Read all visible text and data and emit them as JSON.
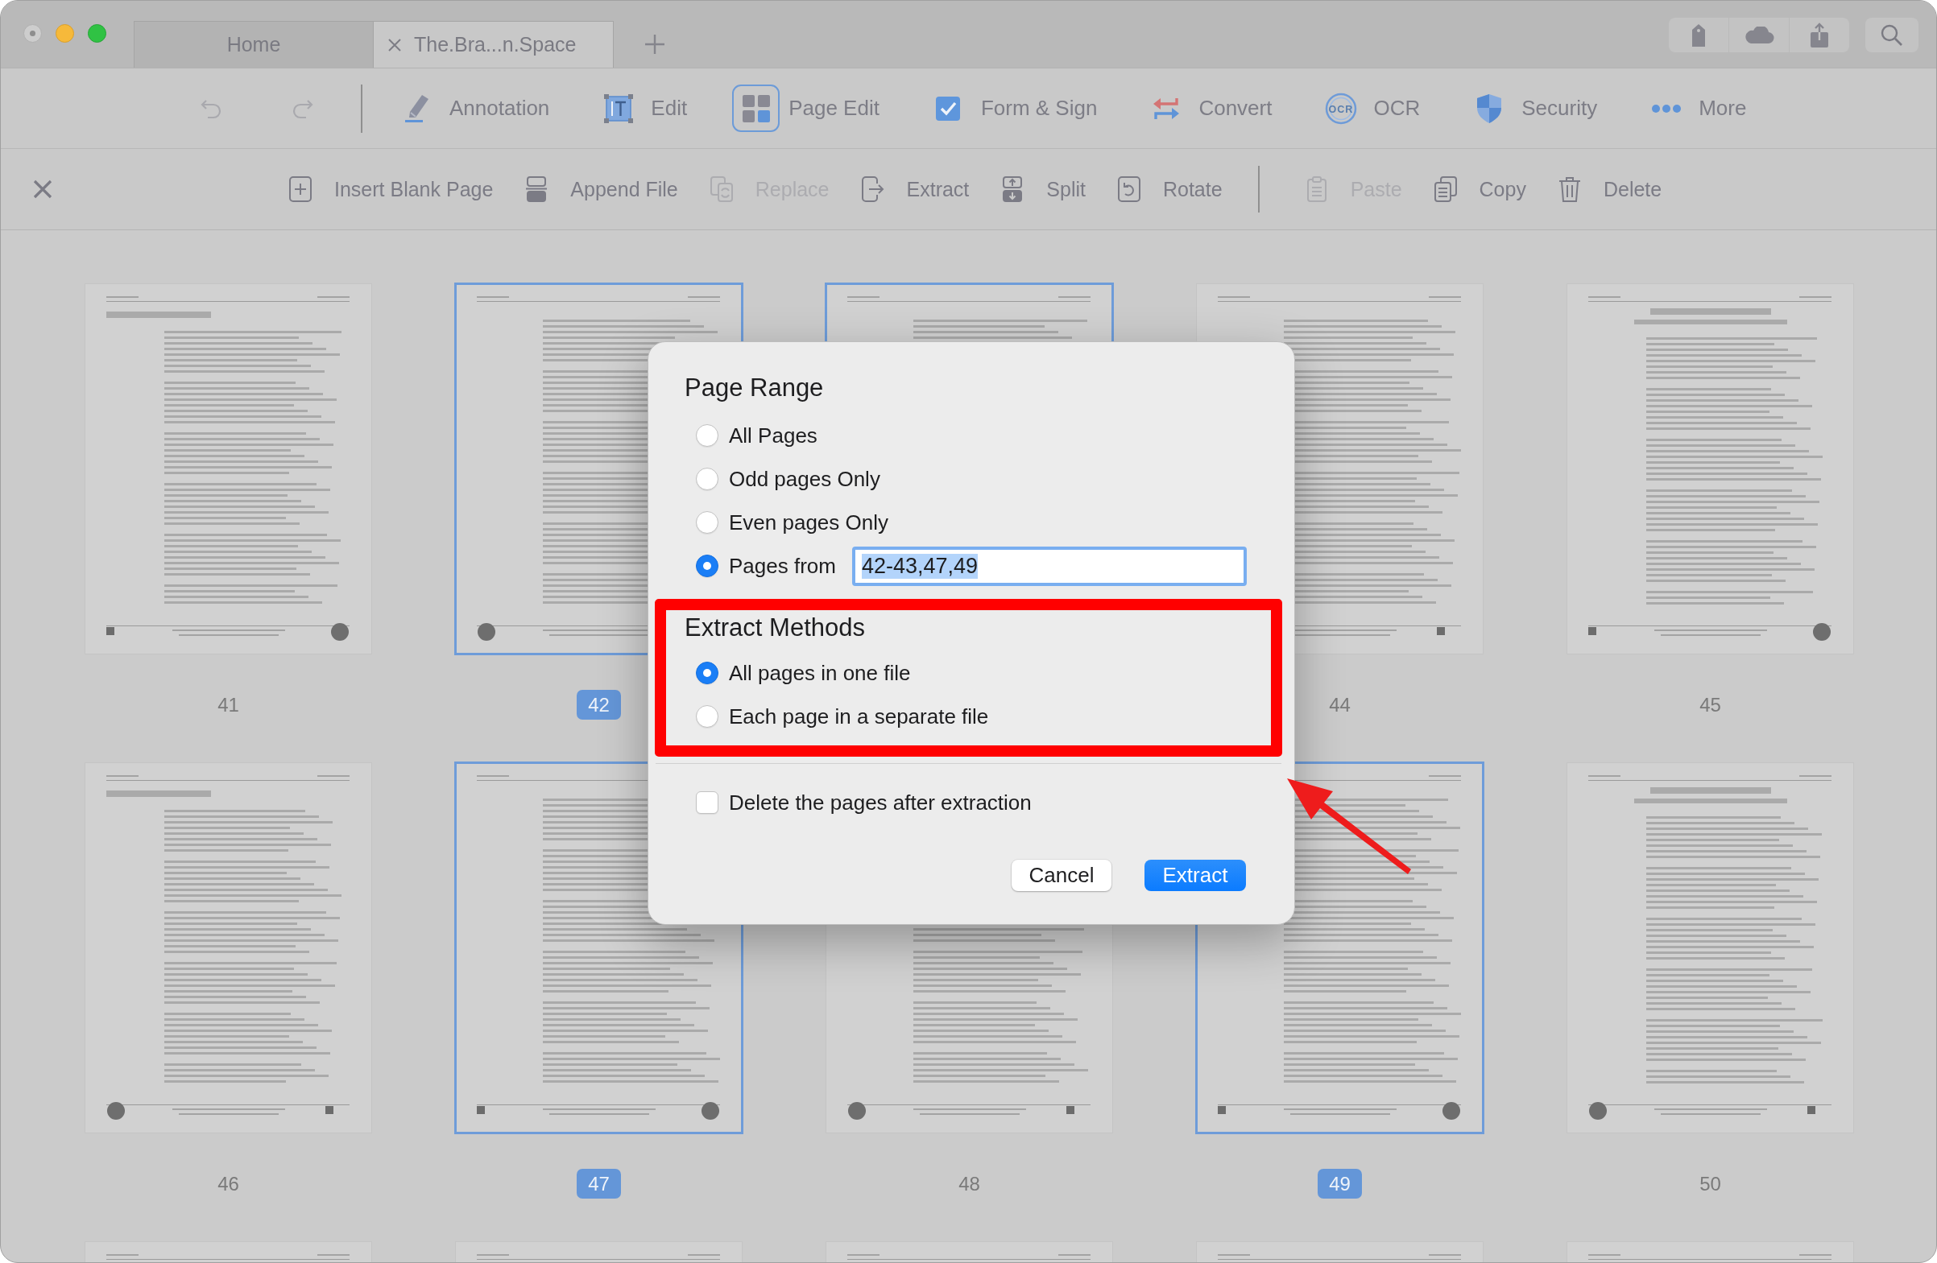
{
  "window": {
    "tabs": [
      {
        "label": "Home",
        "selected": false
      },
      {
        "label": "The.Bra...n.Space",
        "selected": true
      }
    ]
  },
  "history_buttons": [
    {
      "kind": "undo",
      "disabled": true
    },
    {
      "kind": "redo",
      "disabled": true
    }
  ],
  "main_tools": [
    {
      "kind": "annotation",
      "label": "Annotation",
      "selected": false
    },
    {
      "kind": "edit",
      "label": "Edit",
      "selected": false
    },
    {
      "kind": "page_edit",
      "label": "Page Edit",
      "selected": true
    },
    {
      "kind": "form_sign",
      "label": "Form & Sign",
      "selected": false
    },
    {
      "kind": "convert",
      "label": "Convert",
      "selected": false
    },
    {
      "kind": "ocr",
      "label": "OCR",
      "icon_text": "OCR",
      "selected": false
    },
    {
      "kind": "security",
      "label": "Security",
      "selected": false
    },
    {
      "kind": "more",
      "label": "More",
      "selected": false
    }
  ],
  "page_tools": [
    {
      "kind": "insert",
      "label": "Insert Blank Page",
      "disabled": false
    },
    {
      "kind": "append",
      "label": "Append File",
      "disabled": false
    },
    {
      "kind": "replace",
      "label": "Replace",
      "disabled": true
    },
    {
      "kind": "extract",
      "label": "Extract",
      "disabled": false
    },
    {
      "kind": "split",
      "label": "Split",
      "disabled": false
    },
    {
      "kind": "rotate",
      "label": "Rotate",
      "disabled": false
    }
  ],
  "clipboard_tools": [
    {
      "kind": "paste",
      "label": "Paste",
      "disabled": true
    },
    {
      "kind": "copy",
      "label": "Copy",
      "disabled": false
    },
    {
      "kind": "delete",
      "label": "Delete",
      "disabled": false
    }
  ],
  "pages": [
    {
      "number": "41",
      "selected": false
    },
    {
      "number": "42",
      "selected": true
    },
    {
      "selected": true
    },
    {
      "number": "44",
      "selected": false
    },
    {
      "number": "45",
      "selected": false
    },
    {
      "number": "46",
      "selected": false
    },
    {
      "number": "47",
      "selected": true
    },
    {
      "number": "48",
      "selected": false
    },
    {
      "number": "49",
      "selected": true
    },
    {
      "number": "50",
      "selected": false
    },
    {
      "selected": false
    },
    {
      "selected": false
    },
    {
      "selected": false
    },
    {
      "selected": false
    },
    {
      "selected": false
    }
  ],
  "dialog": {
    "page_range": {
      "title": "Page Range",
      "options": [
        {
          "kind": "plain",
          "label": "All Pages",
          "selected": false
        },
        {
          "kind": "plain",
          "label": "Odd pages Only",
          "selected": false
        },
        {
          "kind": "plain",
          "label": "Even pages Only",
          "selected": false
        },
        {
          "kind": "range",
          "label": "Pages from",
          "selected": true,
          "field": {
            "value": "42-43,47,49",
            "highlighted": true
          }
        }
      ]
    },
    "extract_methods": {
      "title": "Extract Methods",
      "options": [
        {
          "label": "All pages in one file",
          "selected": true
        },
        {
          "label": "Each page in a separate file",
          "selected": false
        }
      ]
    },
    "delete_option": {
      "label": "Delete the pages after extraction",
      "checked": false
    },
    "buttons": [
      {
        "kind": "cancel",
        "label": "Cancel"
      },
      {
        "kind": "confirm",
        "label": "Extract"
      }
    ]
  }
}
